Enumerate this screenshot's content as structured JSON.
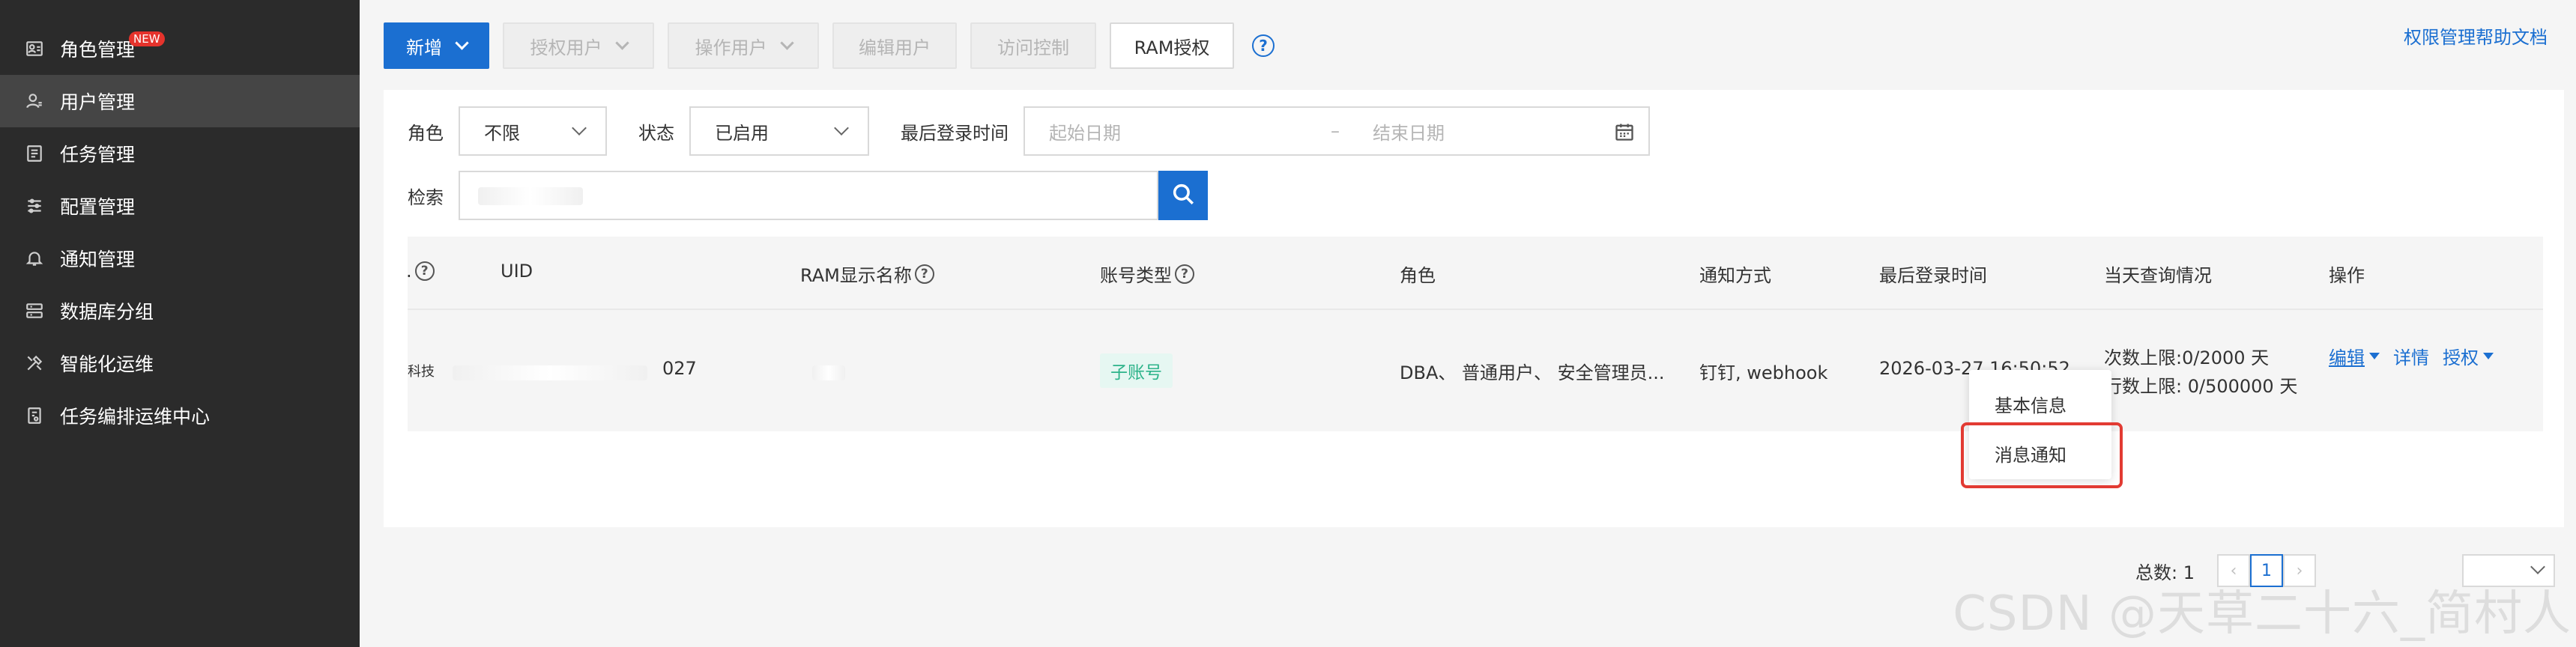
{
  "sidebar": {
    "items": [
      {
        "label": "角色管理",
        "icon": "role-icon",
        "badge": "NEW",
        "active": false
      },
      {
        "label": "用户管理",
        "icon": "user-icon",
        "active": true
      },
      {
        "label": "任务管理",
        "icon": "task-icon",
        "active": false
      },
      {
        "label": "配置管理",
        "icon": "config-icon",
        "active": false
      },
      {
        "label": "通知管理",
        "icon": "bell-icon",
        "active": false
      },
      {
        "label": "数据库分组",
        "icon": "database-group-icon",
        "active": false
      },
      {
        "label": "智能化运维",
        "icon": "tools-icon",
        "active": false
      },
      {
        "label": "任务编排运维中心",
        "icon": "orchestration-icon",
        "active": false
      }
    ]
  },
  "toolbar": {
    "new_label": "新增",
    "grant_user_label": "授权用户",
    "operate_user_label": "操作用户",
    "edit_user_label": "编辑用户",
    "access_control_label": "访问控制",
    "ram_grant_label": "RAM授权",
    "help_symbol": "?",
    "help_doc_link": "权限管理帮助文档"
  },
  "filters": {
    "role_label": "角色",
    "role_value": "不限",
    "status_label": "状态",
    "status_value": "已启用",
    "last_login_label": "最后登录时间",
    "start_date_placeholder": "起始日期",
    "date_separator": "–",
    "end_date_placeholder": "结束日期",
    "search_label": "检索"
  },
  "table": {
    "headers": {
      "first": "?",
      "uid": "UID",
      "ram_name": "RAM显示名称",
      "account_type": "账号类型",
      "role": "角色",
      "notify": "通知方式",
      "last_login": "最后登录时间",
      "daily_query": "当天查询情况",
      "actions": "操作"
    },
    "rows": [
      {
        "first_partial": "科技",
        "uid_partial": "027",
        "account_type": "子账号",
        "role": "DBA、 普通用户、 安全管理员...",
        "notify": "钉钉, webhook",
        "last_login": "2026-03-27 16:50:52",
        "query_count": "次数上限:0/2000 天",
        "row_count": "行数上限: 0/500000 天",
        "action_edit": "编辑",
        "action_detail": "详情",
        "action_grant": "授权"
      }
    ]
  },
  "edit_menu": {
    "items": [
      "基本信息",
      "消息通知"
    ],
    "highlight_color": "#e23b33"
  },
  "pagination": {
    "total_label": "总数: 1",
    "current_page": "1"
  },
  "watermark": "CSDN @天草二十六_简村人",
  "colors": {
    "primary": "#1b6fd1",
    "sidebar_bg": "#2b2b2b",
    "sidebar_active": "#454545",
    "tag_text": "#2db38a",
    "tag_bg": "#e6f7f2",
    "badge": "#e5332c"
  }
}
